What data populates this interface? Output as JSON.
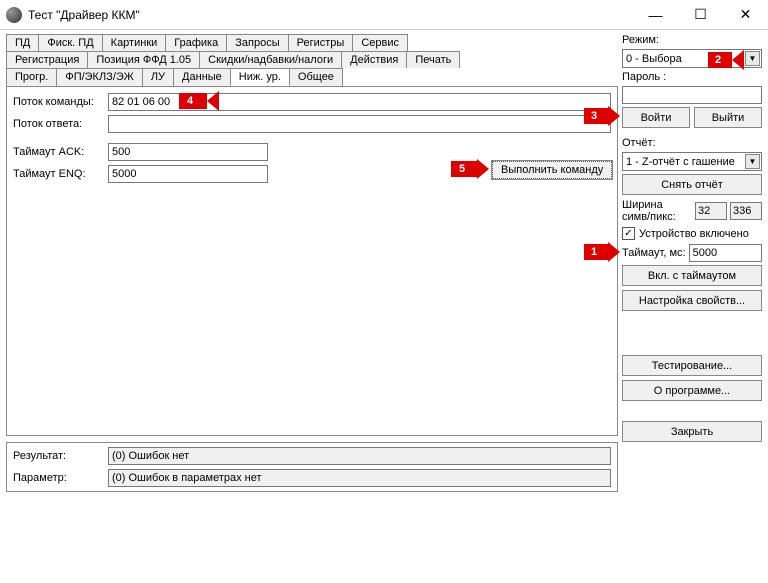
{
  "window": {
    "title": "Тест \"Драйвер ККМ\"",
    "min": "—",
    "max": "☐",
    "close": "✕"
  },
  "tabs_row1": [
    "ПД",
    "Фиск. ПД",
    "Картинки",
    "Графика",
    "Запросы",
    "Регистры",
    "Сервис"
  ],
  "tabs_row2": [
    "Регистрация",
    "Позиция ФФД 1.05",
    "Скидки/надбавки/налоги",
    "Действия",
    "Печать"
  ],
  "tabs_row3": [
    "Прогр.",
    "ФП/ЭКЛЗ/ЭЖ",
    "ЛУ",
    "Данные",
    "Ниж. ур.",
    "Общее"
  ],
  "active_tab": 4,
  "form": {
    "cmd_label": "Поток команды:",
    "cmd_value": "82 01 06 00",
    "resp_label": "Поток ответа:",
    "resp_value": "",
    "ack_label": "Таймаут ACK:",
    "ack_value": "500",
    "enq_label": "Таймаут ENQ:",
    "enq_value": "5000",
    "exec_label": "Выполнить команду"
  },
  "right": {
    "mode_label": "Режим:",
    "mode_value": "0 - Выбора",
    "pwd_label": "Пароль :",
    "pwd_value": "",
    "login": "Войти",
    "logout": "Выйти",
    "report_label": "Отчёт:",
    "report_value": "1 - Z-отчёт с гашение",
    "take_report": "Снять отчёт",
    "width_label": "Ширина симв/пикс:",
    "width_sym": "32",
    "width_pix": "336",
    "device_on": "Устройство включено",
    "timeout_label": "Таймаут, мс:",
    "timeout_value": "5000",
    "with_timeout": "Вкл. с таймаутом",
    "props": "Настройка свойств...",
    "testing": "Тестирование...",
    "about": "О программе...",
    "close_btn": "Закрыть"
  },
  "results": {
    "result_label": "Результат:",
    "result_value": "(0) Ошибок нет",
    "param_label": "Параметр:",
    "param_value": "(0) Ошибок в параметрах нет"
  },
  "callouts": {
    "1": "1",
    "2": "2",
    "3": "3",
    "4": "4",
    "5": "5"
  }
}
